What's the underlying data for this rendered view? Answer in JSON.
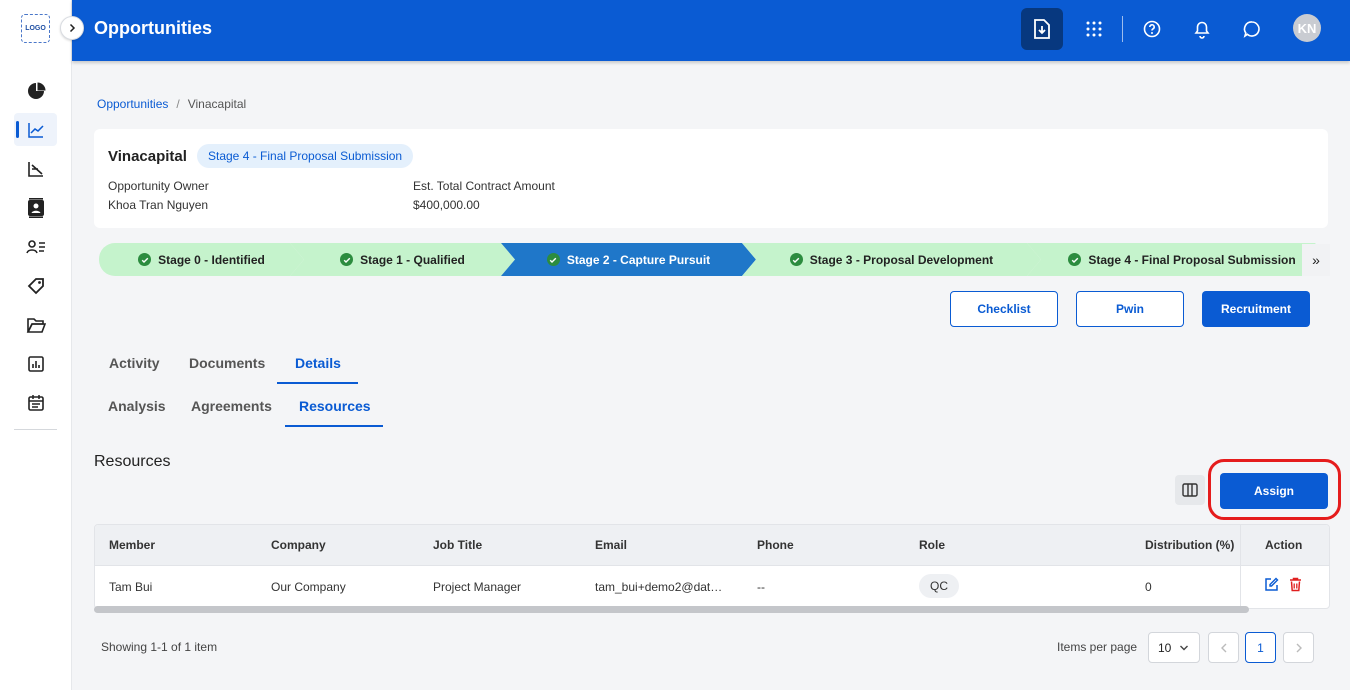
{
  "app": {
    "logo_text": "LOGO",
    "page_title": "Opportunities",
    "avatar_initials": "KN"
  },
  "colors": {
    "primary": "#0a5bd3",
    "stage_done": "#c5f3cc",
    "stage_current": "#1f77c9",
    "highlight": "#e51c1c"
  },
  "sidebar": {
    "items": [
      {
        "icon": "pie-chart-icon",
        "active": false
      },
      {
        "icon": "line-chart-icon",
        "active": true
      },
      {
        "icon": "funnel-chart-icon",
        "active": false
      },
      {
        "icon": "contact-book-icon",
        "active": false
      },
      {
        "icon": "people-list-icon",
        "active": false
      },
      {
        "icon": "tag-icon",
        "active": false
      },
      {
        "icon": "folder-open-icon",
        "active": false
      },
      {
        "icon": "report-icon",
        "active": false
      },
      {
        "icon": "calendar-icon",
        "active": false
      }
    ]
  },
  "topbar": {
    "icons": [
      "download-doc-icon",
      "apps-grid-icon",
      "help-icon",
      "bell-icon",
      "chat-icon"
    ]
  },
  "breadcrumb": {
    "root": "Opportunities",
    "separator": "/",
    "current": "Vinacapital"
  },
  "summary": {
    "name": "Vinacapital",
    "stage": "Stage 4 - Final Proposal Submission",
    "owner_label": "Opportunity Owner",
    "owner_value": "Khoa Tran Nguyen",
    "amount_label": "Est. Total Contract Amount",
    "amount_value": "$400,000.00"
  },
  "stages": [
    {
      "label": "Stage 0 - Identified",
      "status": "done"
    },
    {
      "label": "Stage 1 - Qualified",
      "status": "done"
    },
    {
      "label": "Stage 2 - Capture Pursuit",
      "status": "current"
    },
    {
      "label": "Stage 3 - Proposal Development",
      "status": "done"
    },
    {
      "label": "Stage 4 - Final Proposal Submission",
      "status": "done"
    }
  ],
  "stage_next_glyph": "»",
  "actions": {
    "checklist": "Checklist",
    "pwin": "Pwin",
    "recruitment": "Recruitment"
  },
  "tabs_primary": [
    "Activity",
    "Documents",
    "Details"
  ],
  "tabs_secondary": [
    "Analysis",
    "Agreements",
    "Resources"
  ],
  "resources": {
    "title": "Resources",
    "assign": "Assign",
    "columns": [
      "Member",
      "Company",
      "Job Title",
      "Email",
      "Phone",
      "Role",
      "Distribution (%)",
      "Action"
    ],
    "rows": [
      {
        "member": "Tam Bui",
        "company": "Our Company",
        "job_title": "Project Manager",
        "email": "tam_bui+demo2@dat…",
        "phone": "--",
        "role": "QC",
        "distribution": "0"
      }
    ]
  },
  "pagination": {
    "showing": "Showing 1-1 of 1 item",
    "items_per_page_label": "Items per page",
    "items_per_page": "10",
    "current_page": "1"
  }
}
